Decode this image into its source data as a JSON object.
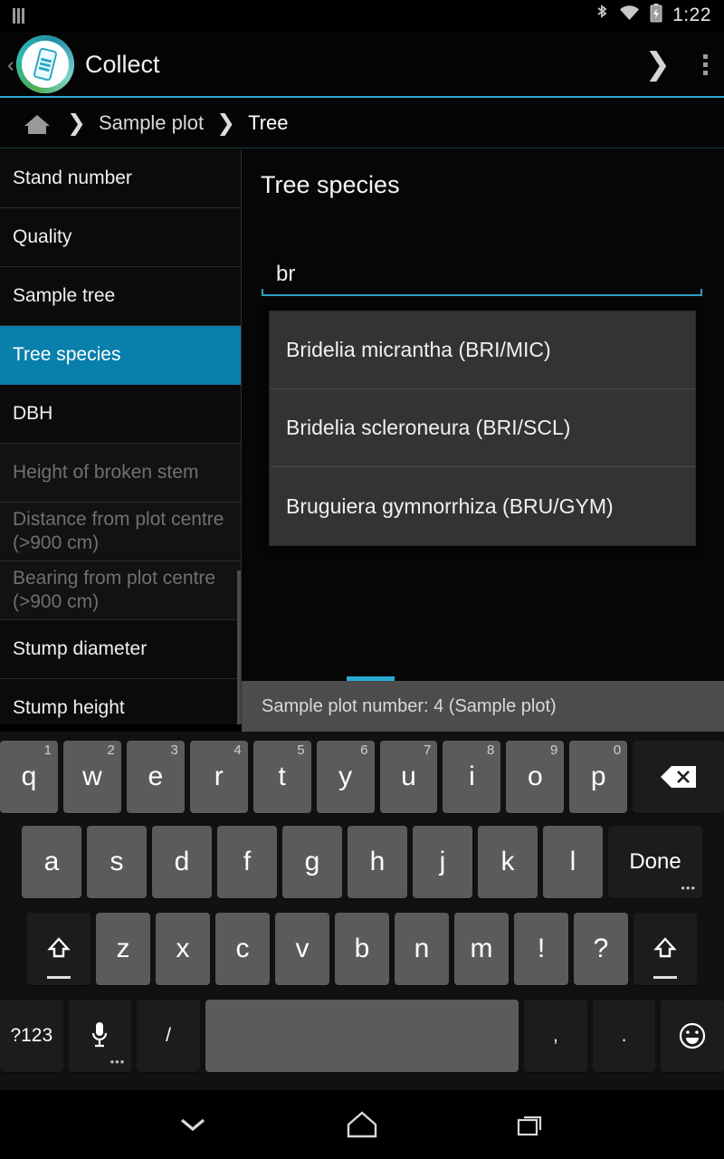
{
  "status_bar": {
    "notification_icon": "bars-icon",
    "bluetooth_icon": "bluetooth-icon",
    "wifi_icon": "wifi-icon",
    "battery_icon": "battery-charging-icon",
    "time": "1:22"
  },
  "action_bar": {
    "back_glyph": "‹",
    "app_icon": "collect-app-icon",
    "title": "Collect",
    "next_glyph": "❯",
    "overflow_icon": "overflow-menu-icon",
    "accent_color": "#2aa9d0"
  },
  "breadcrumb": {
    "home_icon": "home-icon",
    "separator": "❯",
    "items": [
      {
        "label": "Sample plot",
        "current": false
      },
      {
        "label": "Tree",
        "current": true
      }
    ]
  },
  "sidebar": {
    "items": [
      {
        "label": "Stand number",
        "state": "normal"
      },
      {
        "label": "Quality",
        "state": "normal"
      },
      {
        "label": "Sample tree",
        "state": "normal"
      },
      {
        "label": "Tree species",
        "state": "selected"
      },
      {
        "label": "DBH",
        "state": "normal"
      },
      {
        "label": "Height of broken stem",
        "state": "disabled"
      },
      {
        "label": "Distance from plot centre (>900 cm)",
        "state": "disabled"
      },
      {
        "label": "Bearing from plot centre (>900 cm)",
        "state": "disabled"
      },
      {
        "label": "Stump diameter",
        "state": "normal"
      },
      {
        "label": "Stump height",
        "state": "normal"
      }
    ],
    "selected_color": "#0880ab"
  },
  "main": {
    "title": "Tree species",
    "input": {
      "value": "br",
      "placeholder": ""
    },
    "underline_color": "#2b9cc4",
    "suggestions": [
      "Bridelia micrantha (BRI/MIC)",
      "Bridelia scleroneura (BRI/SCL)",
      "Bruguiera gymnorrhiza (BRU/GYM)"
    ]
  },
  "status_strip": {
    "text": "Sample plot number: 4 (Sample plot)",
    "tab_indicator_color": "#2aa9d0"
  },
  "keyboard": {
    "row1": [
      {
        "label": "q",
        "hint": "1"
      },
      {
        "label": "w",
        "hint": "2"
      },
      {
        "label": "e",
        "hint": "3"
      },
      {
        "label": "r",
        "hint": "4"
      },
      {
        "label": "t",
        "hint": "5"
      },
      {
        "label": "y",
        "hint": "6"
      },
      {
        "label": "u",
        "hint": "7"
      },
      {
        "label": "i",
        "hint": "8"
      },
      {
        "label": "o",
        "hint": "9"
      },
      {
        "label": "p",
        "hint": "0"
      }
    ],
    "row2": [
      "a",
      "s",
      "d",
      "f",
      "g",
      "h",
      "j",
      "k",
      "l"
    ],
    "done_label": "Done",
    "row3": [
      "z",
      "x",
      "c",
      "v",
      "b",
      "n",
      "m",
      "!",
      "?"
    ],
    "backspace_icon": "backspace-icon",
    "shift_icon": "shift-icon",
    "sym_label": "?123",
    "mic_icon": "microphone-icon",
    "slash_label": "/",
    "space_label": "",
    "comma_label": ",",
    "period_label": ".",
    "emoji_icon": "emoji-icon",
    "more_dots": "•••"
  },
  "nav_bar": {
    "back_icon": "keyboard-dismiss-icon",
    "home_icon": "home-nav-icon",
    "recents_icon": "recents-icon"
  }
}
